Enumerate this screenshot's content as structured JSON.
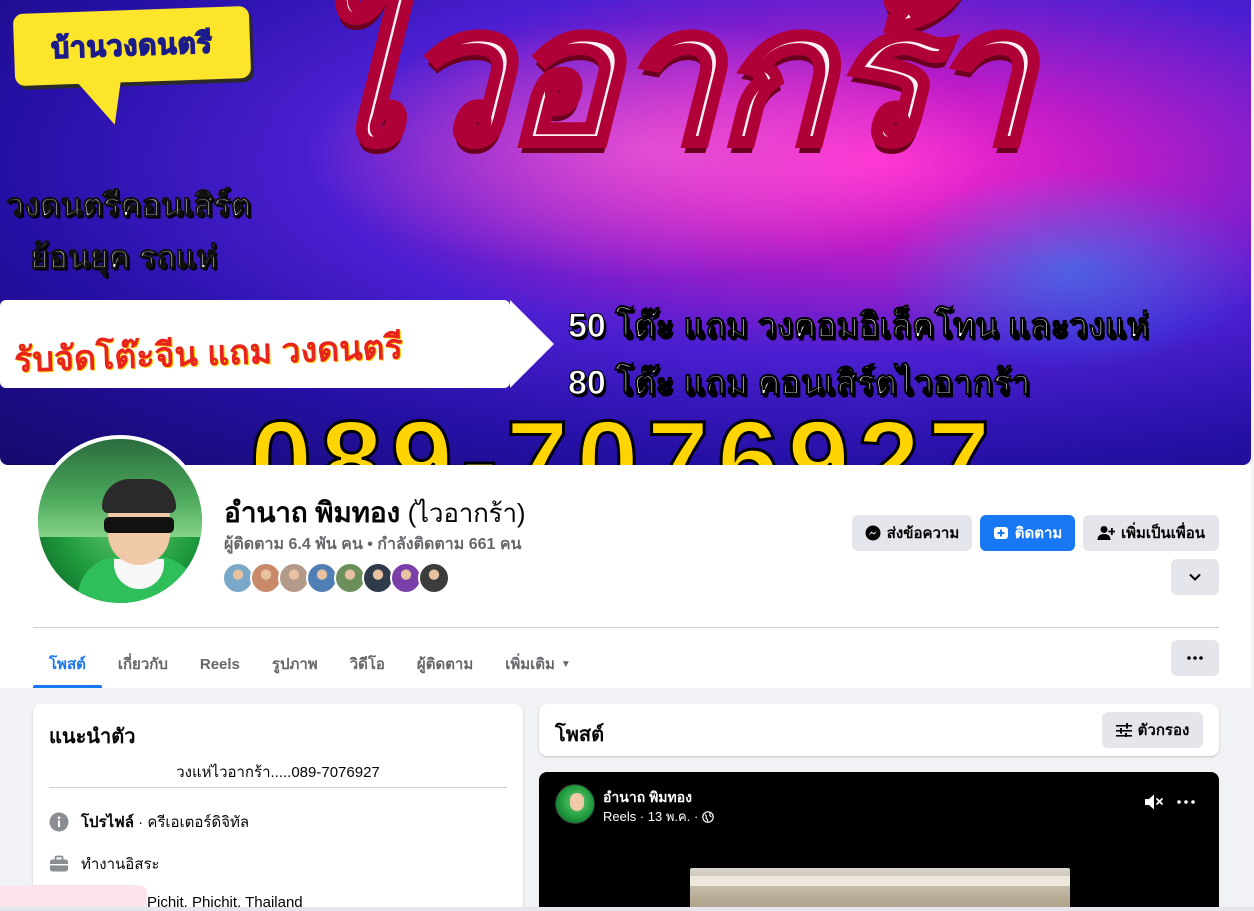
{
  "cover": {
    "sticker": "บ้านวงดนตรี",
    "title": "ไวอากร้า",
    "line1": "วงดนตรีคอนเสิร์ต",
    "line2": "ย้อนยุค รถแห่",
    "banner": "รับจัดโต๊ะจีน แถม วงดนตรี",
    "promo1": "50 โต๊ะ แถม วงคอมอิเล็คโทน และวงแห่",
    "promo2": "80 โต๊ะ แถม คอนเสิร์ตไวอากร้า",
    "phone": "089-7076927"
  },
  "profile": {
    "name": "อำนาถ พิมทอง",
    "alt_name": "(ไวอากร้า)",
    "stats": "ผู้ติดตาม 6.4 พัน คน • กำลังติดตาม 661 คน",
    "friend_colors": [
      "#7aa8c9",
      "#c98a6a",
      "#b39a8a",
      "#4f7fb5",
      "#6b8f5a",
      "#2f3a4a",
      "#7a3fa8",
      "#3c3c3c"
    ]
  },
  "actions": {
    "message": "ส่งข้อความ",
    "follow": "ติดตาม",
    "add_friend": "เพิ่มเป็นเพื่อน"
  },
  "tabs": [
    {
      "label": "โพสต์",
      "active": true
    },
    {
      "label": "เกี่ยวกับ"
    },
    {
      "label": "Reels"
    },
    {
      "label": "รูปภาพ"
    },
    {
      "label": "วิดีโอ"
    },
    {
      "label": "ผู้ติดตาม"
    },
    {
      "label": "เพิ่มเติม"
    }
  ],
  "intro": {
    "title": "แนะนำตัว",
    "bio": "วงแห่ไวอากร้า.....089-7076927",
    "profile_label": "โปรไฟล์",
    "profile_value": " · ครีเอเตอร์ดิจิทัล",
    "work": "ทำงานอิสระ",
    "location": "Pichit, Phichit, Thailand"
  },
  "posts": {
    "title": "โพสต์",
    "filter": "ตัวกรอง"
  },
  "reel": {
    "author": "อำนาถ พิมทอง",
    "meta": "Reels · 13 พ.ค. ·"
  },
  "colors": {
    "accent": "#1877f2",
    "button_gray": "#e4e6eb",
    "background": "#f0f2f5",
    "secondary_text": "#65676b"
  }
}
